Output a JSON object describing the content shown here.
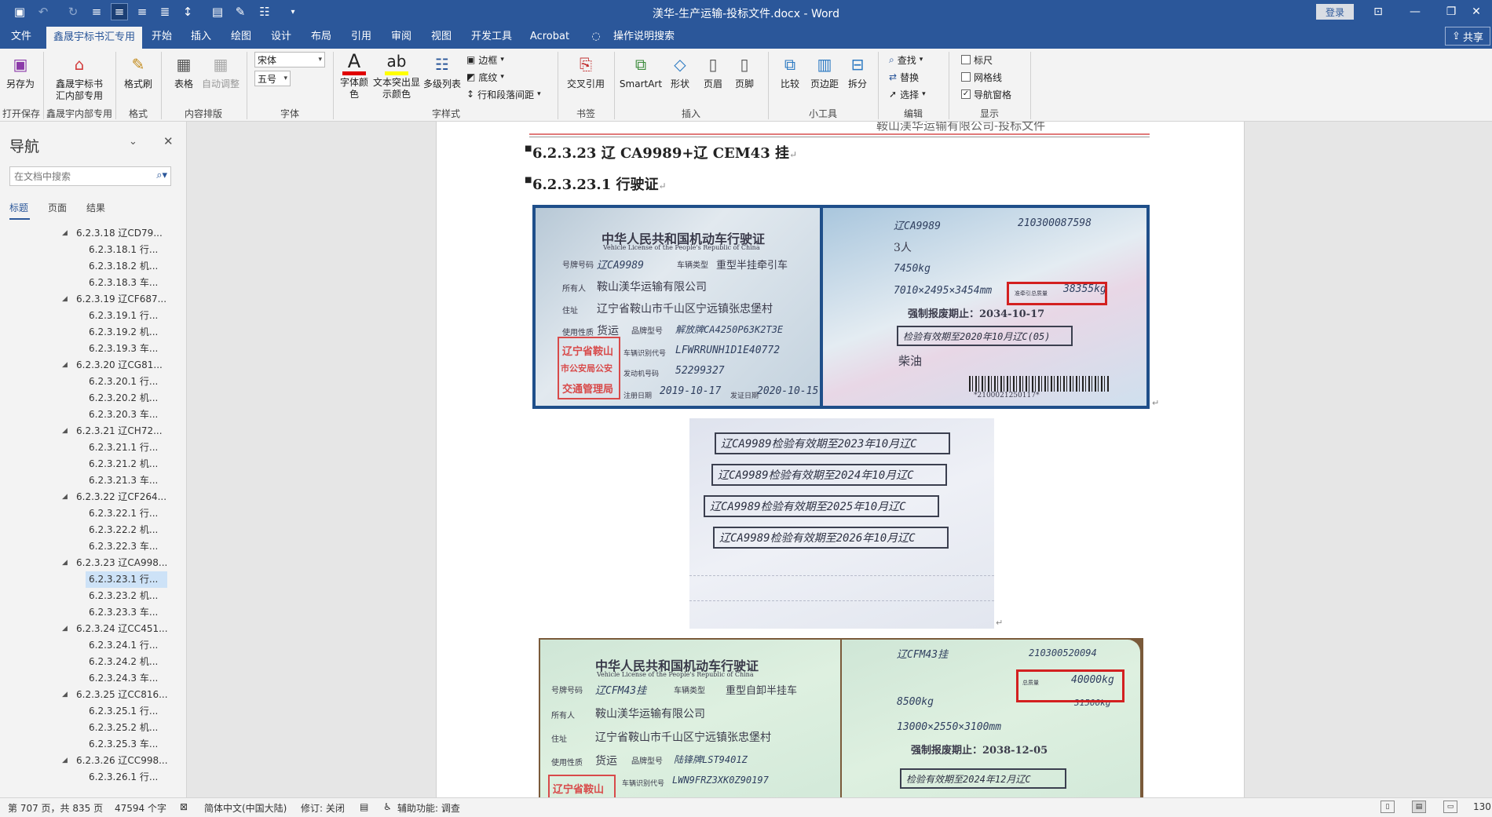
{
  "window": {
    "title": "渼华-生产运输-投标文件.docx - Word",
    "login": "登录"
  },
  "tabs": [
    "文件",
    "鑫晟宇标书汇专用",
    "开始",
    "插入",
    "绘图",
    "设计",
    "布局",
    "引用",
    "审阅",
    "视图",
    "开发工具",
    "Acrobat",
    "操作说明搜索"
  ],
  "active_tab": "鑫晟宇标书汇专用",
  "share_label": "共享",
  "ribbon": {
    "save_as": "另存为",
    "xsy_line1": "鑫晟宇标书",
    "xsy_line2": "汇内部专用",
    "format_painter": "格式刷",
    "table": "表格",
    "auto_adjust": "自动调整",
    "font_name": "宋体",
    "font_size": "五号",
    "font_color_l1": "字体颜",
    "font_color_l2": "色",
    "highlight_l1": "文本突出显",
    "highlight_l2": "示颜色",
    "multilevel": "多级列表",
    "border": "边框",
    "shading": "底纹",
    "line_spacing": "行和段落间距",
    "cross_ref": "交叉引用",
    "smartart": "SmartArt",
    "shape": "形状",
    "header": "页眉",
    "footer": "页脚",
    "compare": "比较",
    "margins": "页边距",
    "split": "拆分",
    "find": "查找",
    "replace": "替换",
    "select": "选择",
    "ruler": "标尺",
    "gridlines": "网格线",
    "nav_pane": "导航窗格",
    "groups": {
      "open_save": "打开保存",
      "xsy": "鑫晟宇内部专用",
      "format": "格式",
      "content": "内容排版",
      "font": "字体",
      "style": "字样式",
      "bookmark": "书签",
      "insert": "插入",
      "tools": "小工具",
      "edit": "编辑",
      "display": "显示"
    }
  },
  "nav": {
    "title": "导航",
    "search_placeholder": "在文档中搜索",
    "tabs": [
      "标题",
      "页面",
      "结果"
    ],
    "items": [
      {
        "level": 1,
        "text": "6.2.3.18 辽CD79..."
      },
      {
        "level": 2,
        "text": "6.2.3.18.1 行..."
      },
      {
        "level": 2,
        "text": "6.2.3.18.2 机..."
      },
      {
        "level": 2,
        "text": "6.2.3.18.3 车..."
      },
      {
        "level": 1,
        "text": "6.2.3.19 辽CF687..."
      },
      {
        "level": 2,
        "text": "6.2.3.19.1 行..."
      },
      {
        "level": 2,
        "text": "6.2.3.19.2 机..."
      },
      {
        "level": 2,
        "text": "6.2.3.19.3 车..."
      },
      {
        "level": 1,
        "text": "6.2.3.20 辽CG81..."
      },
      {
        "level": 2,
        "text": "6.2.3.20.1 行..."
      },
      {
        "level": 2,
        "text": "6.2.3.20.2 机..."
      },
      {
        "level": 2,
        "text": "6.2.3.20.3 车..."
      },
      {
        "level": 1,
        "text": "6.2.3.21 辽CH72..."
      },
      {
        "level": 2,
        "text": "6.2.3.21.1 行..."
      },
      {
        "level": 2,
        "text": "6.2.3.21.2 机..."
      },
      {
        "level": 2,
        "text": "6.2.3.21.3 车..."
      },
      {
        "level": 1,
        "text": "6.2.3.22 辽CF264..."
      },
      {
        "level": 2,
        "text": "6.2.3.22.1 行..."
      },
      {
        "level": 2,
        "text": "6.2.3.22.2 机..."
      },
      {
        "level": 2,
        "text": "6.2.3.22.3 车..."
      },
      {
        "level": 1,
        "text": "6.2.3.23 辽CA998..."
      },
      {
        "level": 2,
        "text": "6.2.3.23.1 行...",
        "selected": true
      },
      {
        "level": 2,
        "text": "6.2.3.23.2 机..."
      },
      {
        "level": 2,
        "text": "6.2.3.23.3 车..."
      },
      {
        "level": 1,
        "text": "6.2.3.24 辽CC451..."
      },
      {
        "level": 2,
        "text": "6.2.3.24.1 行..."
      },
      {
        "level": 2,
        "text": "6.2.3.24.2 机..."
      },
      {
        "level": 2,
        "text": "6.2.3.24.3 车..."
      },
      {
        "level": 1,
        "text": "6.2.3.25 辽CC816..."
      },
      {
        "level": 2,
        "text": "6.2.3.25.1 行..."
      },
      {
        "level": 2,
        "text": "6.2.3.25.2 机..."
      },
      {
        "level": 2,
        "text": "6.2.3.25.3 车..."
      },
      {
        "level": 1,
        "text": "6.2.3.26 辽CC998..."
      },
      {
        "level": 2,
        "text": "6.2.3.26.1 行..."
      }
    ]
  },
  "document": {
    "header_text": "鞍山渼华运输有限公司-投标文件",
    "heading1": "6.2.3.23  辽 CA9989+辽 CEM43 挂",
    "heading2": "6.2.3.23.1 行驶证",
    "license1": {
      "title_cn": "中华人民共和国机动车行驶证",
      "title_en": "Vehicle License of the People's Republic of China",
      "plate_label": "号牌号码",
      "plate": "辽CA9989",
      "type_label": "车辆类型",
      "type": "重型半挂牵引车",
      "owner_label": "所有人",
      "owner": "鞍山渼华运输有限公司",
      "address_label": "住址",
      "address": "辽宁省鞍山市千山区宁远镇张忠堡村",
      "use_label": "使用性质",
      "use": "货运",
      "model_label": "品牌型号",
      "model": "解放牌CA4250P63K2T3E",
      "vin_label": "车辆识别代号",
      "vin": "LFWRRUNH1D1E40772",
      "engine_label": "发动机号码",
      "engine": "52299327",
      "reg_label": "注册日期",
      "reg_date": "2019-10-17",
      "issue_label": "发证日期",
      "issue_date": "2020-10-15",
      "seal_l1": "辽宁省鞍山",
      "seal_l2": "市公安局公安",
      "seal_l3": "交通管理局",
      "file_no": "210300087598",
      "seats": "3人",
      "total_mass": "7450kg",
      "dimensions": "7010×2495×3454mm",
      "tow_mass_label": "准牵引总质量",
      "tow_mass": "38355kg",
      "scrap": "强制报废期止：2034-10-17",
      "inspection": "检验有效期至2020年10月辽C(05)",
      "fuel": "柴油",
      "barcode_num": "*2100021250117*"
    },
    "inspection_stamps": [
      "辽CA9989检验有效期至2023年10月辽C",
      "辽CA9989检验有效期至2024年10月辽C",
      "辽CA9989检验有效期至2025年10月辽C",
      "辽CA9989检验有效期至2026年10月辽C"
    ],
    "license2": {
      "title_cn": "中华人民共和国机动车行驶证",
      "title_en": "Vehicle License of the People's Republic of China",
      "plate_label": "号牌号码",
      "plate": "辽CFM43挂",
      "type_label": "车辆类型",
      "type": "重型自卸半挂车",
      "owner_label": "所有人",
      "owner": "鞍山渼华运输有限公司",
      "address_label": "住址",
      "address": "辽宁省鞍山市千山区宁远镇张忠堡村",
      "use_label": "使用性质",
      "use": "货运",
      "model_label": "品牌型号",
      "model": "陆锋牌LST9401Z",
      "vin_label": "车辆识别代号",
      "vin": "LWN9FRZ3XK0Z90197",
      "seal_l1": "辽宁省鞍山",
      "file_no": "210300520094",
      "total_mass_label": "总质量",
      "total_mass": "40000kg",
      "curb": "8500kg",
      "load": "31500kg",
      "dimensions": "13000×2550×3100mm",
      "scrap": "强制报废期止：2038-12-05",
      "inspection": "检验有效期至2024年12月辽C"
    }
  },
  "status": {
    "page": "第 707 页，共 835 页",
    "words": "47594 个字",
    "lang": "简体中文(中国大陆)",
    "track": "修订: 关闭",
    "accessibility": "辅助功能: 调查",
    "zoom": "130"
  }
}
